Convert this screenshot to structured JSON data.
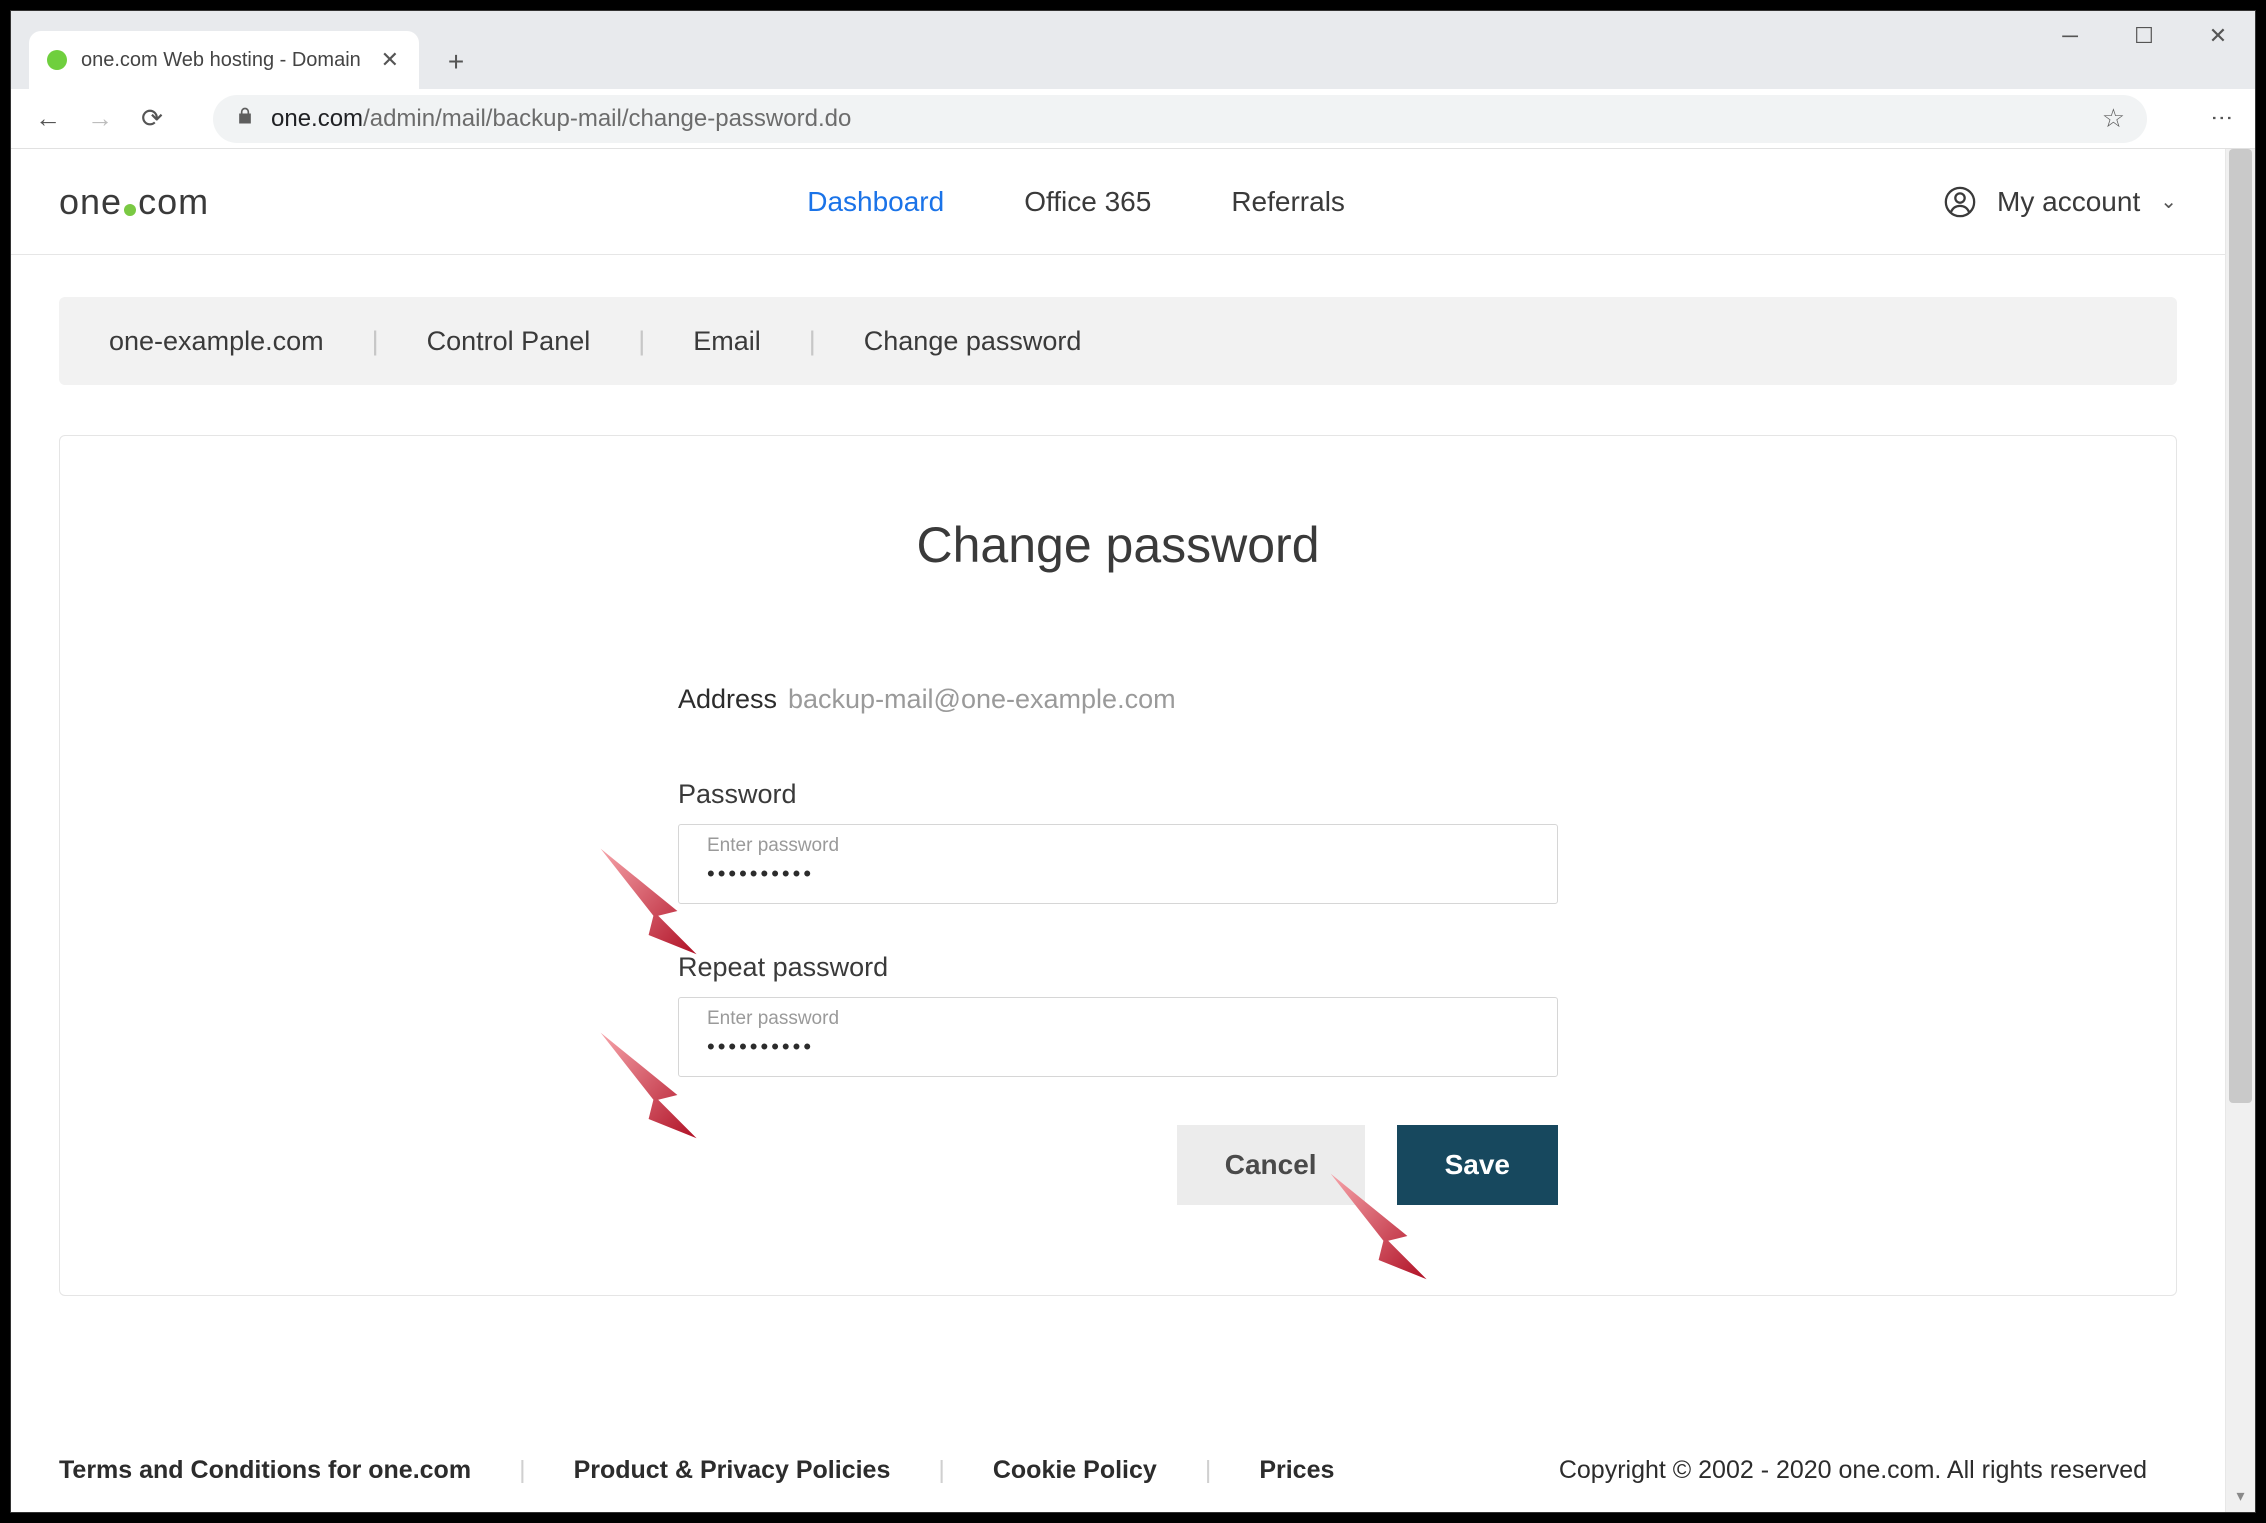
{
  "browser": {
    "tab_title": "one.com Web hosting  -  Domain",
    "url_host": "one.com",
    "url_path": "/admin/mail/backup-mail/change-password.do"
  },
  "topnav": {
    "logo_left": "one",
    "logo_right": "com",
    "links": {
      "dashboard": "Dashboard",
      "office": "Office 365",
      "referrals": "Referrals"
    },
    "account_label": "My account"
  },
  "breadcrumb": {
    "domain": "one-example.com",
    "cp": "Control Panel",
    "email": "Email",
    "current": "Change password"
  },
  "form": {
    "title": "Change password",
    "address_label": "Address",
    "address_value": "backup-mail@one-example.com",
    "password_label": "Password",
    "repeat_label": "Repeat password",
    "float_label": "Enter password",
    "password_value": "••••••••••",
    "repeat_value": "••••••••••",
    "cancel": "Cancel",
    "save": "Save"
  },
  "footer": {
    "terms": "Terms and Conditions for one.com",
    "policies": "Product & Privacy Policies",
    "cookie": "Cookie Policy",
    "prices": "Prices",
    "copyright": "Copyright © 2002 - 2020 one.com. All rights reserved"
  }
}
